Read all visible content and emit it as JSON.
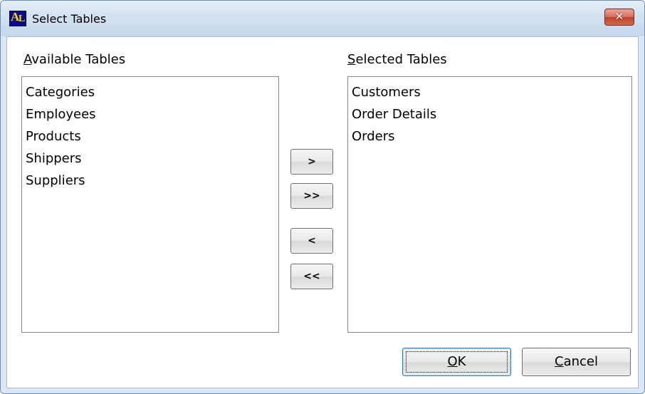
{
  "window": {
    "title": "Select Tables",
    "icon": "app-icon-AL",
    "close_symbol": "✕"
  },
  "available": {
    "label_mnemonic": "A",
    "label_rest": "vailable Tables",
    "items": [
      "Categories",
      "Employees",
      "Products",
      "Shippers",
      "Suppliers"
    ]
  },
  "selected": {
    "label_mnemonic": "S",
    "label_rest": "elected Tables",
    "items": [
      "Customers",
      "Order Details",
      "Orders"
    ]
  },
  "transfer_buttons": {
    "add": ">",
    "add_all": ">>",
    "remove": "<",
    "remove_all": "<<"
  },
  "dialog_buttons": {
    "ok_mnemonic": "O",
    "ok_rest": "K",
    "cancel_mnemonic": "C",
    "cancel_rest": "ancel"
  },
  "colors": {
    "title_gradient_top": "#e6eef8",
    "close_button": "#c0412a",
    "app_icon_bg": "#0a0a8c",
    "app_icon_fg": "#ffd800"
  }
}
